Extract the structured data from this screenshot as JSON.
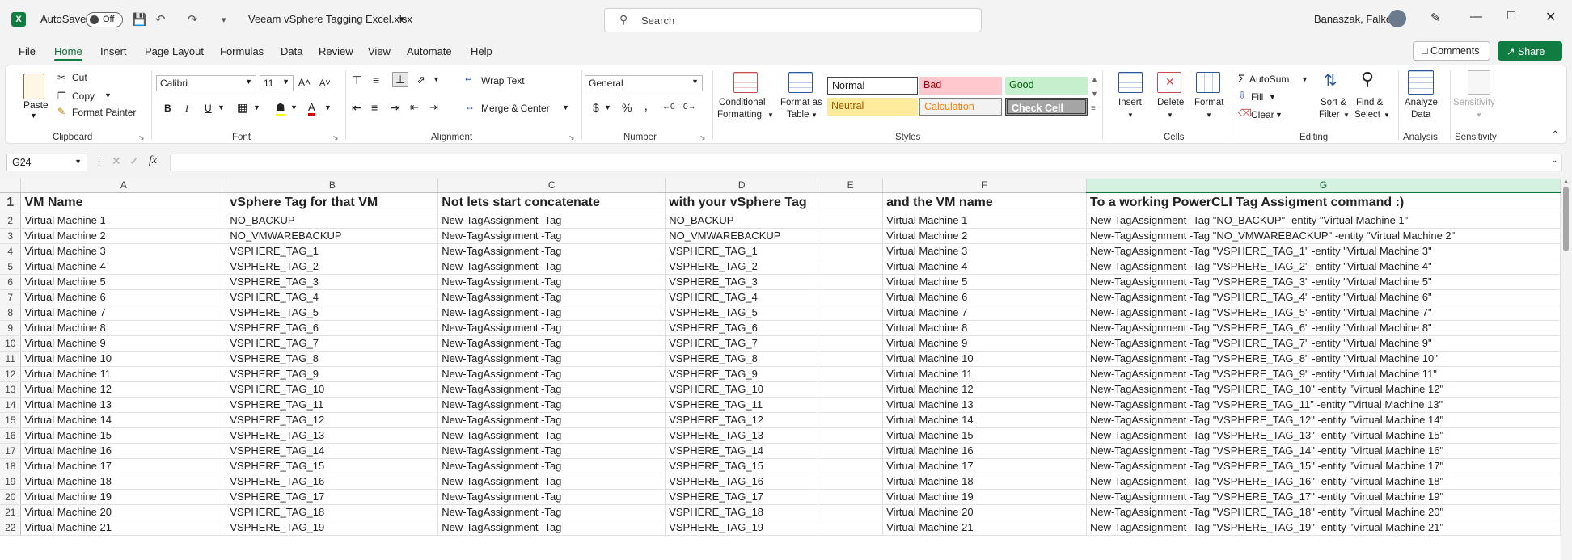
{
  "titlebar": {
    "autosave_label": "AutoSave",
    "autosave_state": "Off",
    "filename": "Veeam vSphere Tagging Excel.xlsx",
    "search_placeholder": "Search",
    "user_name": "Banaszak, Falko"
  },
  "menu_tabs": [
    "File",
    "Home",
    "Insert",
    "Page Layout",
    "Formulas",
    "Data",
    "Review",
    "View",
    "Automate",
    "Help"
  ],
  "active_tab": "Home",
  "top_buttons": {
    "comments": "Comments",
    "share": "Share"
  },
  "ribbon": {
    "clipboard": {
      "label": "Clipboard",
      "paste": "Paste",
      "cut": "Cut",
      "copy": "Copy",
      "format_painter": "Format Painter"
    },
    "font": {
      "label": "Font",
      "family": "Calibri",
      "size": "11"
    },
    "alignment": {
      "label": "Alignment",
      "wrap_text": "Wrap Text",
      "merge_center": "Merge & Center"
    },
    "number": {
      "label": "Number",
      "format": "General"
    },
    "styles": {
      "label": "Styles",
      "conditional_formatting_1": "Conditional",
      "conditional_formatting_2": "Formatting",
      "format_as_table_1": "Format as",
      "format_as_table_2": "Table",
      "cell_styles": [
        "Normal",
        "Bad",
        "Good",
        "Neutral",
        "Calculation",
        "Check Cell"
      ]
    },
    "cells": {
      "label": "Cells",
      "insert": "Insert",
      "delete": "Delete",
      "format": "Format"
    },
    "editing": {
      "label": "Editing",
      "autosum": "AutoSum",
      "fill": "Fill",
      "clear": "Clear",
      "sort_1": "Sort &",
      "sort_2": "Filter",
      "find_1": "Find &",
      "find_2": "Select"
    },
    "analysis": {
      "label": "Analysis",
      "analyze_1": "Analyze",
      "analyze_2": "Data"
    },
    "sensitivity": {
      "label": "Sensitivity",
      "button": "Sensitivity"
    }
  },
  "formula_bar": {
    "name_box": "G24",
    "formula": ""
  },
  "sheet": {
    "columns": [
      "A",
      "B",
      "C",
      "D",
      "E",
      "F",
      "G"
    ],
    "selected_column": "G",
    "header_row": [
      "VM Name",
      "vSphere Tag for that VM",
      "Not lets start concatenate",
      "with your vSphere Tag",
      "",
      "and the VM name",
      "To a working PowerCLI Tag Assigment command :)"
    ],
    "rows": [
      [
        "Virtual Machine 1",
        "NO_BACKUP",
        "New-TagAssignment -Tag",
        "NO_BACKUP",
        "",
        "Virtual Machine 1",
        "New-TagAssignment -Tag \"NO_BACKUP\" -entity \"Virtual Machine 1\""
      ],
      [
        "Virtual Machine 2",
        "NO_VMWAREBACKUP",
        "New-TagAssignment -Tag",
        "NO_VMWAREBACKUP",
        "",
        "Virtual Machine 2",
        "New-TagAssignment -Tag \"NO_VMWAREBACKUP\" -entity \"Virtual Machine 2\""
      ],
      [
        "Virtual Machine 3",
        "VSPHERE_TAG_1",
        "New-TagAssignment -Tag",
        "VSPHERE_TAG_1",
        "",
        "Virtual Machine 3",
        "New-TagAssignment -Tag \"VSPHERE_TAG_1\" -entity \"Virtual Machine 3\""
      ],
      [
        "Virtual Machine 4",
        "VSPHERE_TAG_2",
        "New-TagAssignment -Tag",
        "VSPHERE_TAG_2",
        "",
        "Virtual Machine 4",
        "New-TagAssignment -Tag \"VSPHERE_TAG_2\" -entity \"Virtual Machine 4\""
      ],
      [
        "Virtual Machine 5",
        "VSPHERE_TAG_3",
        "New-TagAssignment -Tag",
        "VSPHERE_TAG_3",
        "",
        "Virtual Machine 5",
        "New-TagAssignment -Tag \"VSPHERE_TAG_3\" -entity \"Virtual Machine 5\""
      ],
      [
        "Virtual Machine 6",
        "VSPHERE_TAG_4",
        "New-TagAssignment -Tag",
        "VSPHERE_TAG_4",
        "",
        "Virtual Machine 6",
        "New-TagAssignment -Tag \"VSPHERE_TAG_4\" -entity \"Virtual Machine 6\""
      ],
      [
        "Virtual Machine 7",
        "VSPHERE_TAG_5",
        "New-TagAssignment -Tag",
        "VSPHERE_TAG_5",
        "",
        "Virtual Machine 7",
        "New-TagAssignment -Tag \"VSPHERE_TAG_5\" -entity \"Virtual Machine 7\""
      ],
      [
        "Virtual Machine 8",
        "VSPHERE_TAG_6",
        "New-TagAssignment -Tag",
        "VSPHERE_TAG_6",
        "",
        "Virtual Machine 8",
        "New-TagAssignment -Tag \"VSPHERE_TAG_6\" -entity \"Virtual Machine 8\""
      ],
      [
        "Virtual Machine 9",
        "VSPHERE_TAG_7",
        "New-TagAssignment -Tag",
        "VSPHERE_TAG_7",
        "",
        "Virtual Machine 9",
        "New-TagAssignment -Tag \"VSPHERE_TAG_7\" -entity \"Virtual Machine 9\""
      ],
      [
        "Virtual Machine 10",
        "VSPHERE_TAG_8",
        "New-TagAssignment -Tag",
        "VSPHERE_TAG_8",
        "",
        "Virtual Machine 10",
        "New-TagAssignment -Tag \"VSPHERE_TAG_8\" -entity \"Virtual Machine 10\""
      ],
      [
        "Virtual Machine 11",
        "VSPHERE_TAG_9",
        "New-TagAssignment -Tag",
        "VSPHERE_TAG_9",
        "",
        "Virtual Machine 11",
        "New-TagAssignment -Tag \"VSPHERE_TAG_9\" -entity \"Virtual Machine 11\""
      ],
      [
        "Virtual Machine 12",
        "VSPHERE_TAG_10",
        "New-TagAssignment -Tag",
        "VSPHERE_TAG_10",
        "",
        "Virtual Machine 12",
        "New-TagAssignment -Tag \"VSPHERE_TAG_10\" -entity \"Virtual Machine 12\""
      ],
      [
        "Virtual Machine 13",
        "VSPHERE_TAG_11",
        "New-TagAssignment -Tag",
        "VSPHERE_TAG_11",
        "",
        "Virtual Machine 13",
        "New-TagAssignment -Tag \"VSPHERE_TAG_11\" -entity \"Virtual Machine 13\""
      ],
      [
        "Virtual Machine 14",
        "VSPHERE_TAG_12",
        "New-TagAssignment -Tag",
        "VSPHERE_TAG_12",
        "",
        "Virtual Machine 14",
        "New-TagAssignment -Tag \"VSPHERE_TAG_12\" -entity \"Virtual Machine 14\""
      ],
      [
        "Virtual Machine 15",
        "VSPHERE_TAG_13",
        "New-TagAssignment -Tag",
        "VSPHERE_TAG_13",
        "",
        "Virtual Machine 15",
        "New-TagAssignment -Tag \"VSPHERE_TAG_13\" -entity \"Virtual Machine 15\""
      ],
      [
        "Virtual Machine 16",
        "VSPHERE_TAG_14",
        "New-TagAssignment -Tag",
        "VSPHERE_TAG_14",
        "",
        "Virtual Machine 16",
        "New-TagAssignment -Tag \"VSPHERE_TAG_14\" -entity \"Virtual Machine 16\""
      ],
      [
        "Virtual Machine 17",
        "VSPHERE_TAG_15",
        "New-TagAssignment -Tag",
        "VSPHERE_TAG_15",
        "",
        "Virtual Machine 17",
        "New-TagAssignment -Tag \"VSPHERE_TAG_15\" -entity \"Virtual Machine 17\""
      ],
      [
        "Virtual Machine 18",
        "VSPHERE_TAG_16",
        "New-TagAssignment -Tag",
        "VSPHERE_TAG_16",
        "",
        "Virtual Machine 18",
        "New-TagAssignment -Tag \"VSPHERE_TAG_16\" -entity \"Virtual Machine 18\""
      ],
      [
        "Virtual Machine 19",
        "VSPHERE_TAG_17",
        "New-TagAssignment -Tag",
        "VSPHERE_TAG_17",
        "",
        "Virtual Machine 19",
        "New-TagAssignment -Tag \"VSPHERE_TAG_17\" -entity \"Virtual Machine 19\""
      ],
      [
        "Virtual Machine 20",
        "VSPHERE_TAG_18",
        "New-TagAssignment -Tag",
        "VSPHERE_TAG_18",
        "",
        "Virtual Machine 20",
        "New-TagAssignment -Tag \"VSPHERE_TAG_18\" -entity \"Virtual Machine 20\""
      ],
      [
        "Virtual Machine 21",
        "VSPHERE_TAG_19",
        "New-TagAssignment -Tag",
        "VSPHERE_TAG_19",
        "",
        "Virtual Machine 21",
        "New-TagAssignment -Tag \"VSPHERE_TAG_19\" -entity \"Virtual Machine 21\""
      ]
    ]
  },
  "colors": {
    "brand": "#107c41",
    "bad_bg": "#ffc7ce",
    "bad_fg": "#9c0006",
    "good_bg": "#c6efce",
    "good_fg": "#006100",
    "neutral_bg": "#ffeb9c",
    "neutral_fg": "#9c5700",
    "calc_fg": "#fa7d00",
    "check_bg": "#a5a5a5"
  }
}
